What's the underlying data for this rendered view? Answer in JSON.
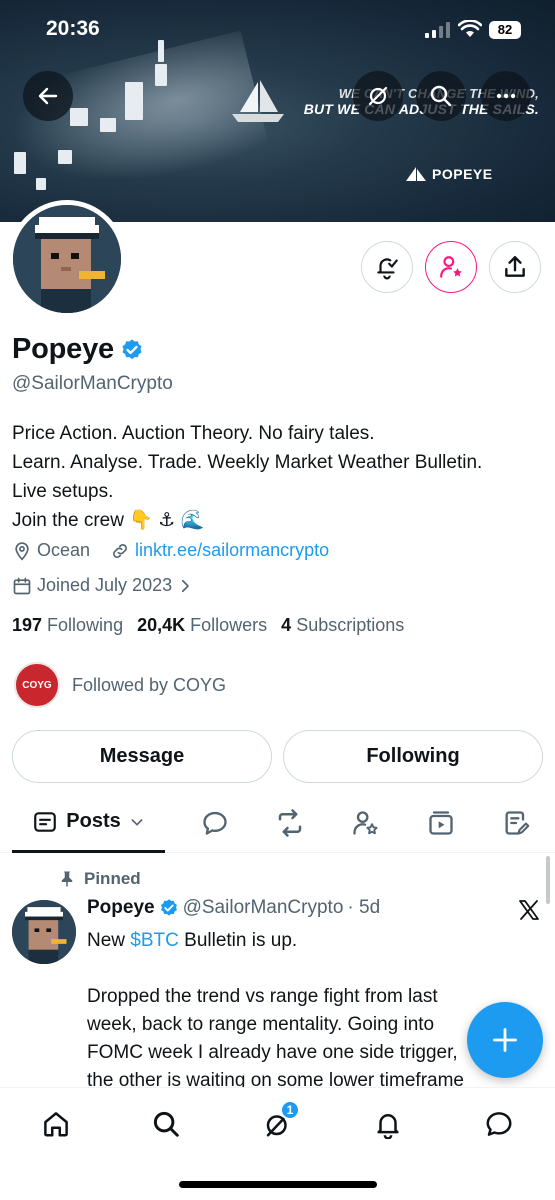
{
  "status_bar": {
    "time": "20:36",
    "battery": "82"
  },
  "banner": {
    "quote_line1": "WE CAN'T CHANGE THE WIND,",
    "quote_line2": "BUT WE CAN ADJUST THE SAILS.",
    "brand": "POPEYE"
  },
  "profile": {
    "name": "Popeye",
    "handle": "@SailorManCrypto",
    "bio": [
      "Price Action. Auction Theory. No fairy tales.",
      "Learn. Analyse. Trade. Weekly Market Weather Bulletin.",
      "Live setups.",
      "Join the crew 👇 ⚓ 🌊"
    ],
    "location": "Ocean",
    "link": "linktr.ee/sailormancrypto",
    "joined": "Joined July 2023"
  },
  "stats": {
    "following_count": "197",
    "following_label": "Following",
    "followers_count": "20,4K",
    "followers_label": "Followers",
    "subs_count": "4",
    "subs_label": "Subscriptions"
  },
  "followed_by": {
    "avatar_text": "COYG",
    "text": "Followed by COYG"
  },
  "buttons": {
    "message": "Message",
    "following": "Following"
  },
  "tabs": {
    "posts": "Posts"
  },
  "post": {
    "pinned_label": "Pinned",
    "author": "Popeye",
    "handle": "@SailorManCrypto",
    "time": "· 5d",
    "line1_pre": "New ",
    "cashtag": "$BTC",
    "line1_post": " Bulletin is up.",
    "lines": [
      "Dropped the trend vs range fight from last",
      "week, back to range mentality. Going into",
      "FOMC week I already have one side trigger,",
      "the other is waiting on some lower timeframe"
    ]
  },
  "nav": {
    "notification_badge": "1"
  },
  "colors": {
    "accent": "#1d9bf0",
    "pink": "#f91880",
    "text": "#0f1419",
    "muted": "#536471"
  }
}
